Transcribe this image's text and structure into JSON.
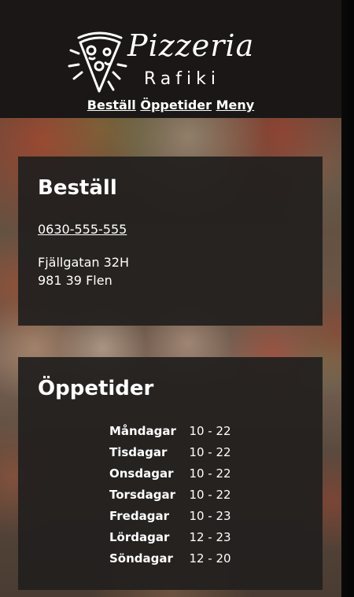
{
  "header": {
    "logo_title": "Pizzeria",
    "logo_subtitle": "Rafiki",
    "nav": [
      {
        "label": "Beställ"
      },
      {
        "label": "Öppetider"
      },
      {
        "label": "Meny"
      }
    ]
  },
  "order": {
    "heading": "Beställ",
    "phone": "0630-555-555",
    "address_line1": "Fjällgatan 32H",
    "address_line2": "981 39 Flen"
  },
  "hours": {
    "heading": "Öppetider",
    "rows": [
      {
        "day": "Måndagar",
        "time": "10 - 22"
      },
      {
        "day": "Tisdagar",
        "time": "10 - 22"
      },
      {
        "day": "Onsdagar",
        "time": "10 - 22"
      },
      {
        "day": "Torsdagar",
        "time": "10 - 22"
      },
      {
        "day": "Fredagar",
        "time": "10 - 23"
      },
      {
        "day": "Lördagar",
        "time": "12 - 23"
      },
      {
        "day": "Söndagar",
        "time": "12 - 20"
      }
    ]
  },
  "colors": {
    "header_bg": "#1a1716",
    "card_bg": "#211f1e",
    "text": "#ffffff"
  },
  "icons": {
    "logo": "pizza-slice-icon"
  }
}
